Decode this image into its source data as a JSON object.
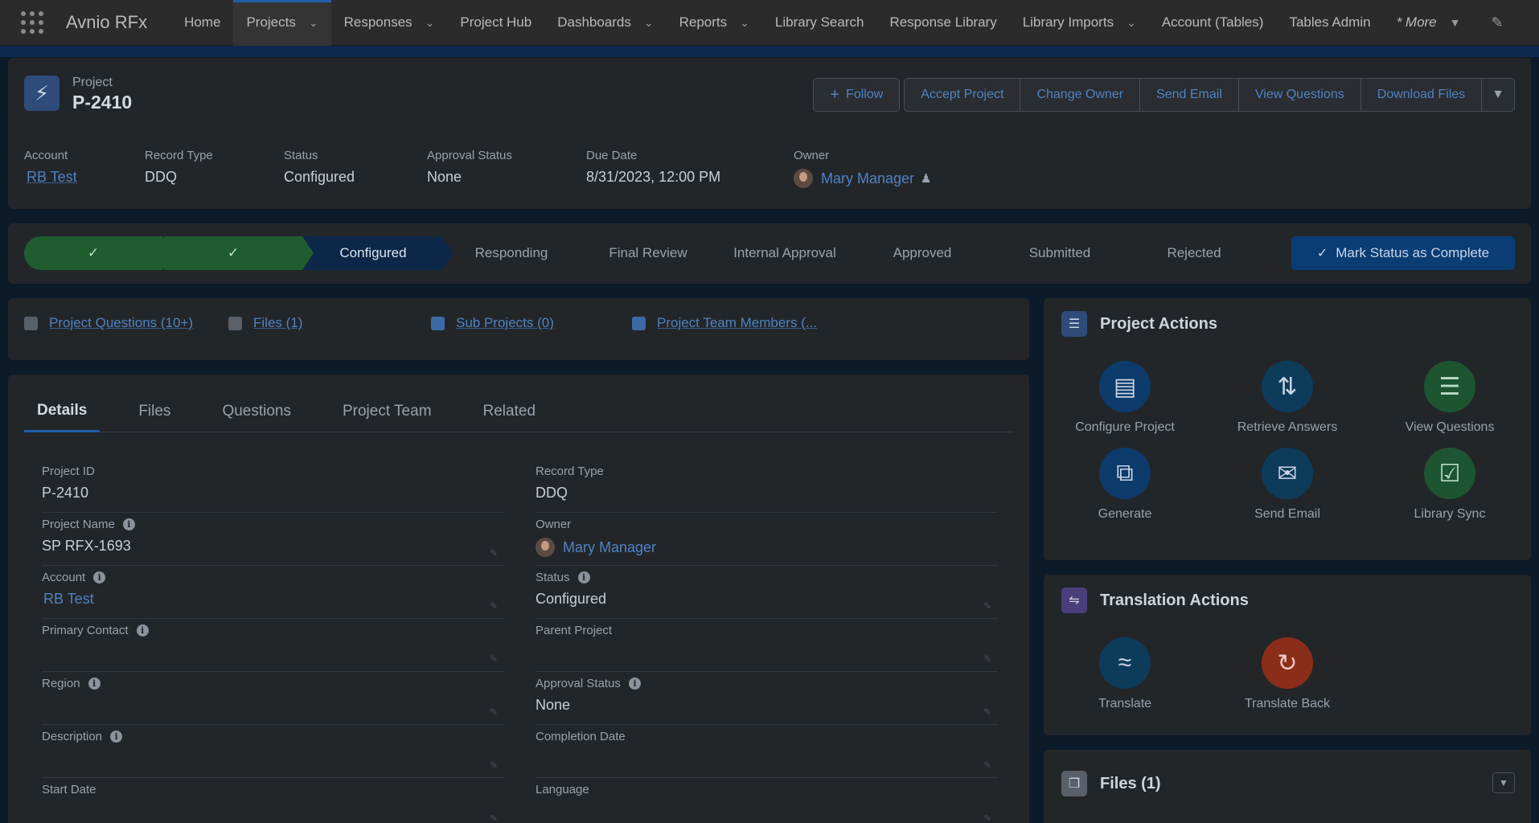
{
  "app": {
    "name": "Avnio RFx",
    "nav": [
      {
        "label": "Home",
        "chevron": false
      },
      {
        "label": "Projects",
        "chevron": true,
        "active": true
      },
      {
        "label": "Responses",
        "chevron": true
      },
      {
        "label": "Project Hub",
        "chevron": false
      },
      {
        "label": "Dashboards",
        "chevron": true
      },
      {
        "label": "Reports",
        "chevron": true
      },
      {
        "label": "Library Search",
        "chevron": false
      },
      {
        "label": "Response Library",
        "chevron": false
      },
      {
        "label": "Library Imports",
        "chevron": true
      },
      {
        "label": "Account (Tables)",
        "chevron": false
      },
      {
        "label": "Tables Admin",
        "chevron": false
      }
    ],
    "more_label": "* More"
  },
  "record": {
    "type_label": "Project",
    "name": "P-2410",
    "buttons": {
      "follow": "Follow",
      "accept": "Accept Project",
      "change_owner": "Change Owner",
      "send_email": "Send Email",
      "view_questions": "View Questions",
      "download_files": "Download Files"
    },
    "highlights": {
      "account_label": "Account",
      "account_value": "RB Test",
      "record_type_label": "Record Type",
      "record_type_value": "DDQ",
      "status_label": "Status",
      "status_value": "Configured",
      "approval_label": "Approval Status",
      "approval_value": "None",
      "due_label": "Due Date",
      "due_value": "8/31/2023, 12:00 PM",
      "owner_label": "Owner",
      "owner_value": "Mary Manager"
    }
  },
  "path": {
    "steps": [
      "",
      "",
      "Configured",
      "Responding",
      "Final Review",
      "Internal Approval",
      "Approved",
      "Submitted",
      "Rejected"
    ],
    "mark_complete": "Mark Status as Complete"
  },
  "quick_links": [
    "Project Questions (10+)",
    "Files (1)",
    "Sub Projects (0)",
    "Project Team Members (..."
  ],
  "tabs": [
    "Details",
    "Files",
    "Questions",
    "Project Team",
    "Related"
  ],
  "details": {
    "left": [
      {
        "label": "Project ID",
        "value": "P-2410"
      },
      {
        "label": "Project Name",
        "value": "SP RFX-1693"
      },
      {
        "label": "Account",
        "value": "RB Test"
      },
      {
        "label": "Primary Contact",
        "value": ""
      },
      {
        "label": "Region",
        "value": ""
      },
      {
        "label": "Description",
        "value": ""
      },
      {
        "label": "Start Date",
        "value": ""
      }
    ],
    "right": [
      {
        "label": "Record Type",
        "value": "DDQ"
      },
      {
        "label": "Owner",
        "value": "Mary Manager"
      },
      {
        "label": "Status",
        "value": "Configured"
      },
      {
        "label": "Parent Project",
        "value": ""
      },
      {
        "label": "Approval Status",
        "value": "None"
      },
      {
        "label": "Completion Date",
        "value": ""
      },
      {
        "label": "Language",
        "value": ""
      }
    ]
  },
  "project_actions": {
    "title": "Project Actions",
    "items": [
      "Configure Project",
      "Retrieve Answers",
      "View Questions",
      "Generate",
      "Send Email",
      "Library Sync"
    ]
  },
  "translation_actions": {
    "title": "Translation Actions",
    "items": [
      "Translate",
      "Translate Back"
    ]
  },
  "files_panel": {
    "title": "Files (1)"
  },
  "colors": {
    "done_step": "#1f5c2e",
    "current_step": "#0d2748",
    "link": "#4f83c4",
    "brand_button": "#0b3d75"
  }
}
